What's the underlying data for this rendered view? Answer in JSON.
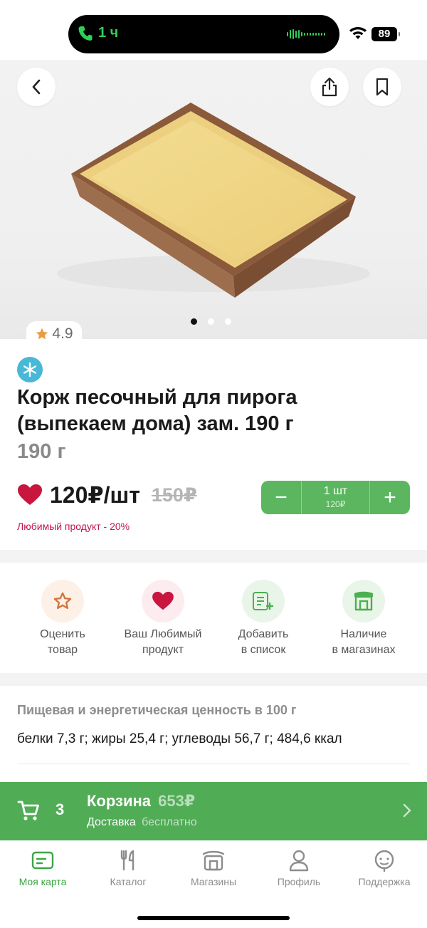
{
  "status_bar": {
    "call_duration": "1 ч",
    "battery": "89"
  },
  "hero": {
    "rating": "4.9",
    "gallery_count": 3,
    "gallery_active": 0
  },
  "product": {
    "title": "Корж песочный для пирога (выпекаем дома) зам. 190 г",
    "weight": "190 г",
    "price": "120₽/шт",
    "old_price": "150₽",
    "favorite_note": "Любимый продукт - 20%",
    "stepper": {
      "minus": "−",
      "plus": "+",
      "quantity": "1 шт",
      "sum": "120₽"
    }
  },
  "actions": [
    {
      "label": "Оценить товар",
      "icon": "star-icon"
    },
    {
      "label": "Ваш Любимый продукт",
      "icon": "heart-icon"
    },
    {
      "label": "Добавить в список",
      "icon": "add-to-list-icon"
    },
    {
      "label": "Наличие в магазинах",
      "icon": "store-icon"
    }
  ],
  "nutrition": {
    "title": "Пищевая и энергетическая ценность в 100 г",
    "value": "белки 7,3 г; жиры 25,4 г; углеводы 56,7 г; 484,6 ккал"
  },
  "cart": {
    "count": "3",
    "title": "Корзина",
    "total": "653₽",
    "delivery_label": "Доставка",
    "delivery_value": "бесплатно"
  },
  "tabbar": [
    {
      "label": "Моя карта",
      "icon": "card-icon",
      "active": true
    },
    {
      "label": "Каталог",
      "icon": "fork-knife-icon",
      "active": false
    },
    {
      "label": "Магазины",
      "icon": "store-icon",
      "active": false
    },
    {
      "label": "Профиль",
      "icon": "person-icon",
      "active": false
    },
    {
      "label": "Поддержка",
      "icon": "headset-icon",
      "active": false
    }
  ],
  "colors": {
    "accent_green": "#5bb65f",
    "cart_green": "#51ac56",
    "tab_active": "#3da643",
    "heart_red": "#c8163f",
    "frozen_blue": "#48b8d6"
  }
}
